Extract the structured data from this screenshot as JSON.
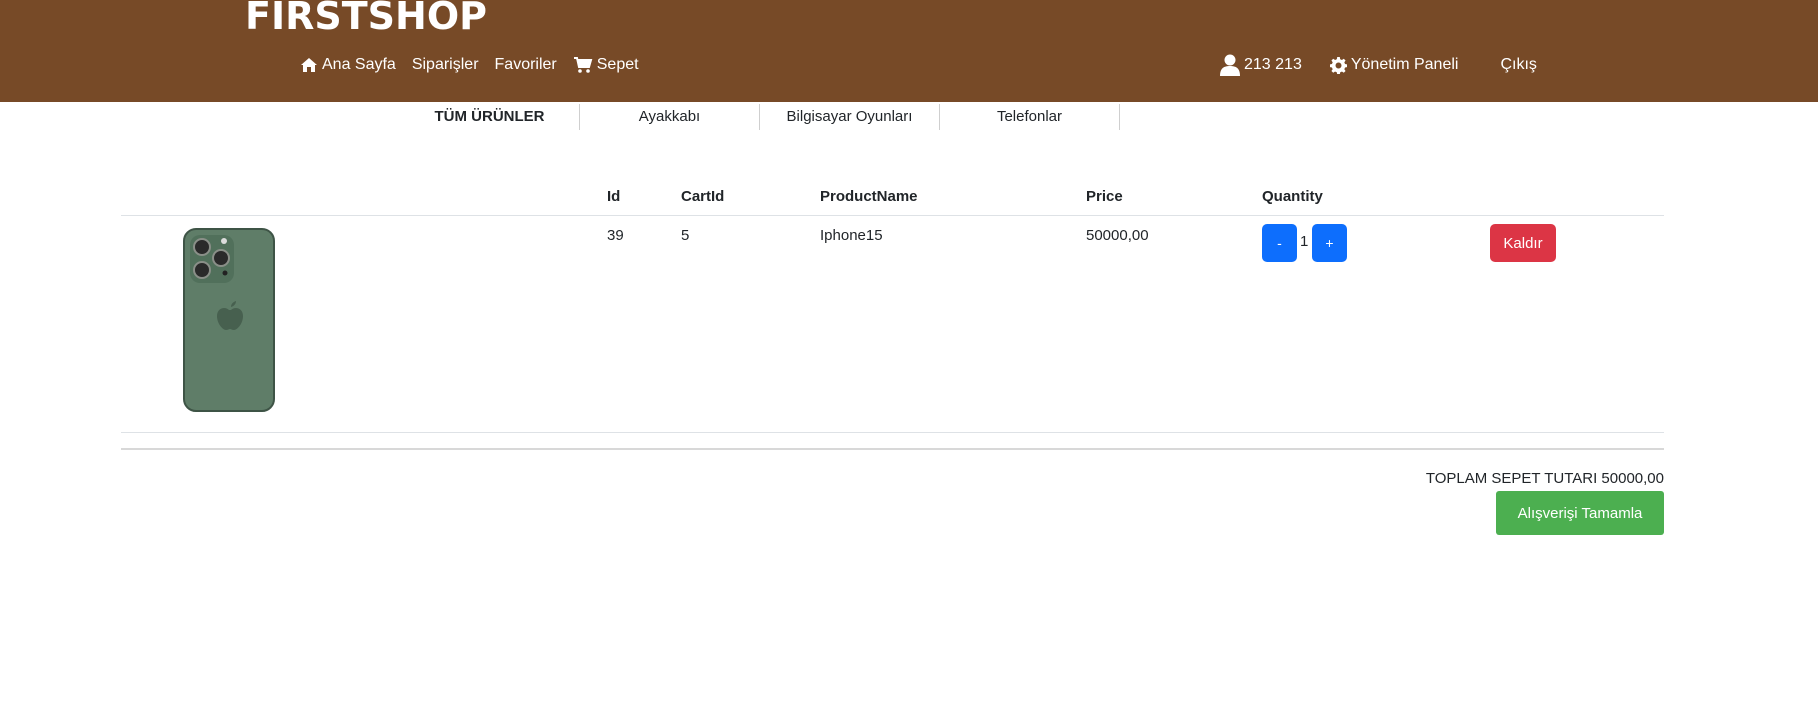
{
  "brand": "FIRSTSHOP",
  "nav": {
    "home": "Ana Sayfa",
    "orders": "Siparişler",
    "favorites": "Favoriler",
    "cart": "Sepet",
    "user": "213 213",
    "admin": "Yönetim Paneli",
    "logout": "Çıkış"
  },
  "categories": [
    "TÜM ÜRÜNLER",
    "Ayakkabı",
    "Bilgisayar Oyunları",
    "Telefonlar"
  ],
  "table": {
    "headers": [
      "Id",
      "CartId",
      "ProductName",
      "Price",
      "Quantity"
    ],
    "rows": [
      {
        "id": "39",
        "cart_id": "5",
        "product_name": "Iphone15",
        "price": "50000,00",
        "quantity": "1"
      }
    ],
    "minus_label": "-",
    "plus_label": "+",
    "remove_label": "Kaldır"
  },
  "total_text": "TOPLAM SEPET TUTARI 50000,00",
  "checkout_label": "Alışverişi Tamamla",
  "colors": {
    "header_bg": "#774a27",
    "primary": "#0d6efd",
    "danger": "#dc3545",
    "success": "#4caf50"
  },
  "icons": [
    "home-icon",
    "cart-icon",
    "user-icon",
    "gear-icon"
  ]
}
